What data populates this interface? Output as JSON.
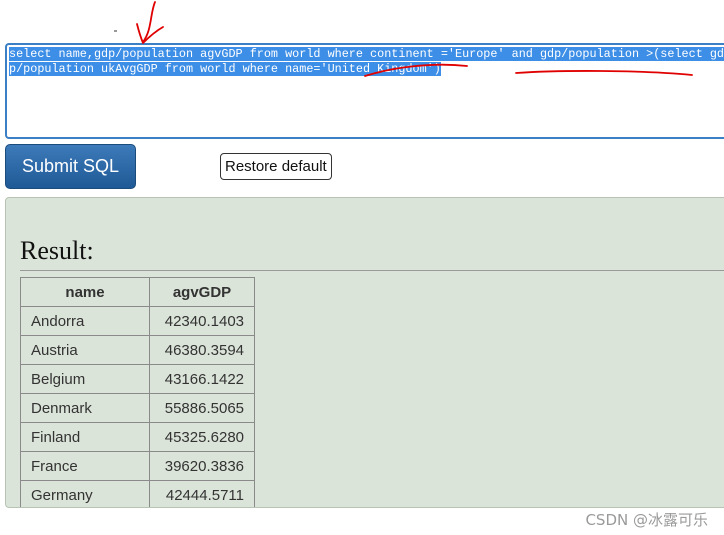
{
  "sql_query": "select name,gdp/population agvGDP from world where continent ='Europe' and gdp/population >(select gdp/population ukAvgGDP from world where name='United Kingdom')",
  "buttons": {
    "submit_label": "Submit SQL",
    "restore_label": "Restore default"
  },
  "result": {
    "title": "Result:",
    "columns": [
      "name",
      "agvGDP"
    ],
    "rows": [
      [
        "Andorra",
        "42340.1403"
      ],
      [
        "Austria",
        "46380.3594"
      ],
      [
        "Belgium",
        "43166.1422"
      ],
      [
        "Denmark",
        "55886.5065"
      ],
      [
        "Finland",
        "45325.6280"
      ],
      [
        "France",
        "39620.3836"
      ],
      [
        "Germany",
        "42444.5711"
      ]
    ]
  },
  "watermark": "CSDN @冰露可乐",
  "colors": {
    "selection": "#3d8ee6",
    "annotation": "#e00000",
    "panel": "#dbe4d9",
    "button": "#2a6aa8"
  }
}
